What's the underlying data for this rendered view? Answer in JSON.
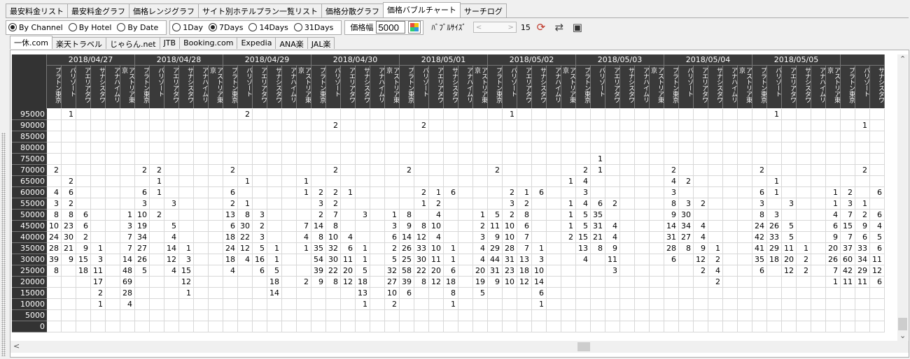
{
  "top_tabs": [
    "最安料金リスト",
    "最安料金グラフ",
    "価格レンジグラフ",
    "サイト別ホテルプラン一覧リスト",
    "価格分散グラフ",
    "価格バブルチャート",
    "サーチログ"
  ],
  "top_tab_active": 5,
  "group_by": {
    "options": [
      "By Channel",
      "By Hotel",
      "By Date"
    ],
    "selected": 0
  },
  "period": {
    "options": [
      "1Day",
      "7Days",
      "14Days",
      "31Days"
    ],
    "selected": 1
  },
  "price_width": {
    "label": "価格幅",
    "value": "5000"
  },
  "bubble_size": {
    "label": "ﾊﾞﾌﾞﾙｻｲｽﾞ",
    "value": "15"
  },
  "sub_tabs": [
    "一休.com",
    "楽天トラベル",
    "じゃらん.net",
    "JTB",
    "Booking.com",
    "Expedia",
    "ANA楽",
    "JAL楽"
  ],
  "sub_tab_active": 0,
  "dates": [
    "2018/04/27",
    "2018/04/28",
    "2018/04/29",
    "2018/04/30",
    "2018/05/01",
    "2018/05/02",
    "2018/05/03",
    "2018/05/04",
    "2018/05/05"
  ],
  "hotels": [
    "プラトン東京",
    "バリゾート",
    "アエリアタワ",
    "サナシスタワ",
    "アナハイムリ",
    "アストリア東京"
  ],
  "trailing_hotels": [
    "プラトン東京",
    "バリゾート",
    "サナシスタワ"
  ],
  "prices": [
    "95000",
    "90000",
    "85000",
    "80000",
    "75000",
    "70000",
    "65000",
    "60000",
    "55000",
    "50000",
    "45000",
    "40000",
    "35000",
    "30000",
    "25000",
    "20000",
    "15000",
    "10000",
    "5000",
    "0"
  ],
  "rows": [
    [
      "",
      "1",
      "",
      "",
      "",
      "",
      "",
      "",
      "",
      "",
      "",
      "",
      "",
      "2",
      "",
      "",
      "",
      "",
      "",
      "",
      "",
      "",
      "",
      "",
      "",
      "",
      "",
      "",
      "",
      "",
      "",
      "1",
      "",
      "",
      "",
      "",
      "",
      "",
      "",
      "",
      "",
      "",
      "",
      "",
      "",
      "",
      "",
      "",
      "",
      "1",
      "",
      "",
      "",
      "",
      "",
      "",
      ""
    ],
    [
      "",
      "",
      "",
      "",
      "",
      "",
      "",
      "",
      "",
      "",
      "",
      "",
      "",
      "",
      "",
      "",
      "",
      "",
      "",
      "2",
      "",
      "",
      "",
      "",
      "",
      "2",
      "",
      "",
      "",
      "",
      "",
      "",
      "",
      "",
      "",
      "",
      "",
      "",
      "",
      "",
      "",
      "",
      "",
      "",
      "",
      "",
      "",
      "",
      "",
      "",
      "",
      "",
      "",
      "",
      "",
      "1",
      ""
    ],
    [
      "",
      "",
      "",
      "",
      "",
      "",
      "",
      "",
      "",
      "",
      "",
      "",
      "",
      "",
      "",
      "",
      "",
      "",
      "",
      "",
      "",
      "",
      "",
      "",
      "",
      "",
      "",
      "",
      "",
      "",
      "",
      "",
      "",
      "",
      "",
      "",
      "",
      "",
      "",
      "",
      "",
      "",
      "",
      "",
      "",
      "",
      "",
      "",
      "",
      "",
      "",
      "",
      "",
      "",
      "",
      "",
      ""
    ],
    [
      "",
      "",
      "",
      "",
      "",
      "",
      "",
      "",
      "",
      "",
      "",
      "",
      "",
      "",
      "",
      "",
      "",
      "",
      "",
      "",
      "",
      "",
      "",
      "",
      "",
      "",
      "",
      "",
      "",
      "",
      "",
      "",
      "",
      "",
      "",
      "",
      "",
      "",
      "",
      "",
      "",
      "",
      "",
      "",
      "",
      "",
      "",
      "",
      "",
      "",
      "",
      "",
      "",
      "",
      "",
      "",
      ""
    ],
    [
      "",
      "",
      "",
      "",
      "",
      "",
      "",
      "",
      "",
      "",
      "",
      "",
      "",
      "",
      "",
      "",
      "",
      "",
      "",
      "",
      "",
      "",
      "",
      "",
      "",
      "",
      "",
      "",
      "",
      "",
      "",
      "",
      "",
      "",
      "",
      "",
      "",
      "1",
      "",
      "",
      "",
      "",
      "",
      "",
      "",
      "",
      "",
      "",
      "",
      "",
      "",
      "",
      "",
      "",
      "",
      "",
      ""
    ],
    [
      "2",
      "",
      "",
      "",
      "",
      "",
      "2",
      "2",
      "",
      "",
      "",
      "",
      "2",
      "",
      "",
      "",
      "",
      "",
      "",
      "2",
      "",
      "",
      "",
      "",
      "2",
      "",
      "",
      "",
      "",
      "",
      "2",
      "",
      "",
      "",
      "",
      "",
      "2",
      "1",
      "",
      "",
      "",
      "",
      "2",
      "",
      "",
      "",
      "",
      "",
      "2",
      "",
      "",
      "",
      "",
      "",
      "",
      "2",
      ""
    ],
    [
      "",
      "2",
      "",
      "",
      "",
      "",
      "",
      "1",
      "",
      "",
      "",
      "",
      "",
      "1",
      "",
      "",
      "",
      "1",
      "",
      "",
      "",
      "",
      "",
      "",
      "",
      "",
      "",
      "",
      "",
      "",
      "",
      "",
      "",
      "",
      "",
      "1",
      "4",
      "",
      "",
      "",
      "",
      "",
      "4",
      "2",
      "",
      "",
      "",
      "",
      "",
      "1",
      "",
      "",
      "",
      "",
      "",
      "",
      ""
    ],
    [
      "4",
      "6",
      "",
      "",
      "",
      "",
      "6",
      "1",
      "",
      "",
      "",
      "",
      "6",
      "",
      "",
      "",
      "",
      "1",
      "2",
      "2",
      "1",
      "",
      "",
      "",
      "",
      "2",
      "1",
      "6",
      "",
      "",
      "",
      "2",
      "1",
      "6",
      "",
      "",
      "3",
      "",
      "",
      "",
      "",
      "",
      "3",
      "",
      "",
      "",
      "",
      "",
      "6",
      "1",
      "",
      "",
      "",
      "1",
      "2",
      "",
      "6"
    ],
    [
      "3",
      "2",
      "",
      "",
      "",
      "",
      "3",
      "",
      "3",
      "",
      "",
      "",
      "2",
      "1",
      "",
      "",
      "",
      "",
      "3",
      "2",
      "",
      "",
      "",
      "",
      "",
      "1",
      "2",
      "",
      "",
      "",
      "",
      "3",
      "2",
      "",
      "",
      "1",
      "4",
      "6",
      "2",
      "",
      "",
      "",
      "8",
      "3",
      "2",
      "",
      "",
      "",
      "3",
      "",
      "3",
      "",
      "",
      "1",
      "3",
      "1",
      ""
    ],
    [
      "8",
      "8",
      "6",
      "",
      "",
      "1",
      "10",
      "2",
      "",
      "",
      "",
      "",
      "13",
      "8",
      "3",
      "",
      "",
      "",
      "2",
      "7",
      "",
      "3",
      "",
      "1",
      "8",
      "",
      "4",
      "",
      "",
      "1",
      "5",
      "2",
      "8",
      "",
      "",
      "1",
      "5",
      "35",
      "",
      "",
      "",
      "",
      "9",
      "30",
      "",
      "",
      "",
      "",
      "8",
      "3",
      "",
      "",
      "",
      "4",
      "7",
      "2",
      "6"
    ],
    [
      "10",
      "23",
      "6",
      "",
      "",
      "3",
      "19",
      "",
      "5",
      "",
      "",
      "",
      "6",
      "30",
      "2",
      "",
      "",
      "7",
      "14",
      "8",
      "",
      "",
      "",
      "3",
      "9",
      "8",
      "10",
      "",
      "",
      "2",
      "11",
      "10",
      "6",
      "",
      "",
      "1",
      "5",
      "31",
      "4",
      "",
      "",
      "",
      "14",
      "34",
      "4",
      "",
      "",
      "",
      "24",
      "26",
      "5",
      "",
      "",
      "6",
      "15",
      "9",
      "4"
    ],
    [
      "24",
      "30",
      "2",
      "",
      "",
      "7",
      "34",
      "",
      "4",
      "",
      "",
      "",
      "18",
      "22",
      "3",
      "",
      "",
      "4",
      "8",
      "10",
      "4",
      "",
      "",
      "6",
      "14",
      "12",
      "4",
      "",
      "",
      "3",
      "9",
      "10",
      "7",
      "",
      "",
      "2",
      "15",
      "21",
      "4",
      "",
      "",
      "",
      "31",
      "27",
      "4",
      "",
      "",
      "",
      "42",
      "33",
      "5",
      "",
      "",
      "9",
      "7",
      "6",
      "5"
    ],
    [
      "28",
      "21",
      "9",
      "1",
      "",
      "7",
      "27",
      "",
      "14",
      "1",
      "",
      "",
      "24",
      "12",
      "5",
      "1",
      "",
      "1",
      "35",
      "32",
      "6",
      "1",
      "",
      "2",
      "26",
      "33",
      "10",
      "1",
      "",
      "4",
      "29",
      "28",
      "7",
      "1",
      "",
      "",
      "13",
      "8",
      "9",
      "",
      "",
      "",
      "28",
      "8",
      "9",
      "1",
      "",
      "",
      "41",
      "29",
      "11",
      "1",
      "",
      "20",
      "37",
      "33",
      "6"
    ],
    [
      "39",
      "9",
      "15",
      "3",
      "",
      "14",
      "26",
      "",
      "12",
      "3",
      "",
      "",
      "18",
      "4",
      "16",
      "1",
      "",
      "",
      "54",
      "30",
      "11",
      "1",
      "",
      "5",
      "25",
      "30",
      "11",
      "1",
      "",
      "4",
      "44",
      "31",
      "13",
      "3",
      "",
      "",
      "4",
      "",
      "11",
      "",
      "",
      "",
      "6",
      "",
      "12",
      "2",
      "",
      "",
      "35",
      "18",
      "20",
      "2",
      "",
      "26",
      "60",
      "34",
      "11"
    ],
    [
      "8",
      "",
      "18",
      "11",
      "",
      "48",
      "5",
      "",
      "4",
      "15",
      "",
      "",
      "4",
      "",
      "6",
      "5",
      "",
      "",
      "39",
      "22",
      "20",
      "5",
      "",
      "32",
      "58",
      "22",
      "20",
      "6",
      "",
      "20",
      "31",
      "23",
      "18",
      "10",
      "",
      "",
      "",
      "",
      "3",
      "",
      "",
      "",
      "",
      "",
      "2",
      "4",
      "",
      "",
      "6",
      "",
      "12",
      "2",
      "",
      "7",
      "42",
      "29",
      "12"
    ],
    [
      "",
      "",
      "",
      "17",
      "",
      "69",
      "",
      "",
      "",
      "12",
      "",
      "",
      "",
      "",
      "",
      "18",
      "",
      "2",
      "9",
      "8",
      "12",
      "18",
      "",
      "27",
      "39",
      "8",
      "12",
      "18",
      "",
      "19",
      "9",
      "10",
      "12",
      "14",
      "",
      "",
      "",
      "",
      "",
      "",
      "",
      "",
      "",
      "",
      "",
      "2",
      "",
      "",
      "",
      "",
      "",
      "",
      "",
      "1",
      "11",
      "11",
      "6"
    ],
    [
      "",
      "",
      "",
      "2",
      "",
      "28",
      "",
      "",
      "",
      "1",
      "",
      "",
      "",
      "",
      "",
      "14",
      "",
      "",
      "",
      "",
      "",
      "13",
      "",
      "10",
      "6",
      "",
      "",
      "8",
      "",
      "5",
      "",
      "",
      "",
      "6",
      "",
      "",
      "",
      "",
      "",
      "",
      "",
      "",
      "",
      "",
      "",
      "",
      "",
      "",
      "",
      "",
      "",
      "",
      "",
      "",
      "",
      "",
      ""
    ],
    [
      "",
      "",
      "",
      "1",
      "",
      "4",
      "",
      "",
      "",
      "",
      "",
      "",
      "",
      "",
      "",
      "",
      "",
      "",
      "",
      "",
      "",
      "1",
      "",
      "2",
      "",
      "",
      "",
      "1",
      "",
      "",
      "",
      "",
      "",
      "1",
      "",
      "",
      "",
      "",
      "",
      "",
      "",
      "",
      "",
      "",
      "",
      "",
      "",
      "",
      "",
      "",
      "",
      "",
      "",
      "",
      "",
      "",
      ""
    ],
    [
      "",
      "",
      "",
      "",
      "",
      "",
      "",
      "",
      "",
      "",
      "",
      "",
      "",
      "",
      "",
      "",
      "",
      "",
      "",
      "",
      "",
      "",
      "",
      "",
      "",
      "",
      "",
      "",
      "",
      "",
      "",
      "",
      "",
      "",
      "",
      "",
      "",
      "",
      "",
      "",
      "",
      "",
      "",
      "",
      "",
      "",
      "",
      "",
      "",
      "",
      "",
      "",
      "",
      "",
      "",
      "",
      ""
    ],
    [
      "",
      "",
      "",
      "",
      "",
      "",
      "",
      "",
      "",
      "",
      "",
      "",
      "",
      "",
      "",
      "",
      "",
      "",
      "",
      "",
      "",
      "",
      "",
      "",
      "",
      "",
      "",
      "",
      "",
      "",
      "",
      "",
      "",
      "",
      "",
      "",
      "",
      "",
      "",
      "",
      "",
      "",
      "",
      "",
      "",
      "",
      "",
      "",
      "",
      "",
      "",
      "",
      "",
      "",
      "",
      "",
      ""
    ]
  ]
}
